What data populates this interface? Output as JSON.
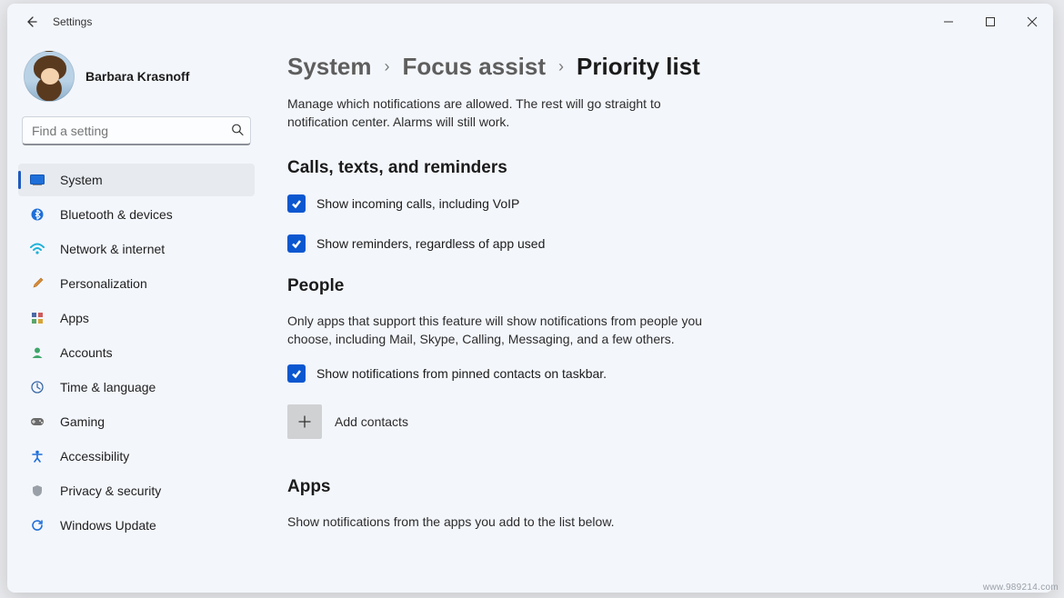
{
  "window": {
    "title": "Settings"
  },
  "user": {
    "name": "Barbara Krasnoff"
  },
  "search": {
    "placeholder": "Find a setting"
  },
  "nav": {
    "items": [
      {
        "id": "system",
        "label": "System",
        "icon": "system-icon",
        "selected": true
      },
      {
        "id": "bluetooth",
        "label": "Bluetooth & devices",
        "icon": "bluetooth-icon",
        "selected": false
      },
      {
        "id": "network",
        "label": "Network & internet",
        "icon": "wifi-icon",
        "selected": false
      },
      {
        "id": "personalization",
        "label": "Personalization",
        "icon": "paintbrush-icon",
        "selected": false
      },
      {
        "id": "apps",
        "label": "Apps",
        "icon": "apps-icon",
        "selected": false
      },
      {
        "id": "accounts",
        "label": "Accounts",
        "icon": "person-icon",
        "selected": false
      },
      {
        "id": "time",
        "label": "Time & language",
        "icon": "globe-clock-icon",
        "selected": false
      },
      {
        "id": "gaming",
        "label": "Gaming",
        "icon": "gamepad-icon",
        "selected": false
      },
      {
        "id": "accessibility",
        "label": "Accessibility",
        "icon": "accessibility-icon",
        "selected": false
      },
      {
        "id": "privacy",
        "label": "Privacy & security",
        "icon": "shield-icon",
        "selected": false
      },
      {
        "id": "update",
        "label": "Windows Update",
        "icon": "update-icon",
        "selected": false
      }
    ]
  },
  "breadcrumb": {
    "parts": [
      "System",
      "Focus assist",
      "Priority list"
    ]
  },
  "page": {
    "description": "Manage which notifications are allowed. The rest will go straight to notification center. Alarms will still work.",
    "sections": {
      "calls": {
        "title": "Calls, texts, and reminders",
        "options": [
          {
            "label": "Show incoming calls, including VoIP",
            "checked": true
          },
          {
            "label": "Show reminders, regardless of app used",
            "checked": true
          }
        ]
      },
      "people": {
        "title": "People",
        "description": "Only apps that support this feature will show notifications from people you choose, including Mail, Skype, Calling, Messaging, and a few others.",
        "options": [
          {
            "label": "Show notifications from pinned contacts on taskbar.",
            "checked": true
          }
        ],
        "add_button": "Add contacts"
      },
      "apps": {
        "title": "Apps",
        "description": "Show notifications from the apps you add to the list below."
      }
    }
  },
  "watermark": "www.989214.com"
}
